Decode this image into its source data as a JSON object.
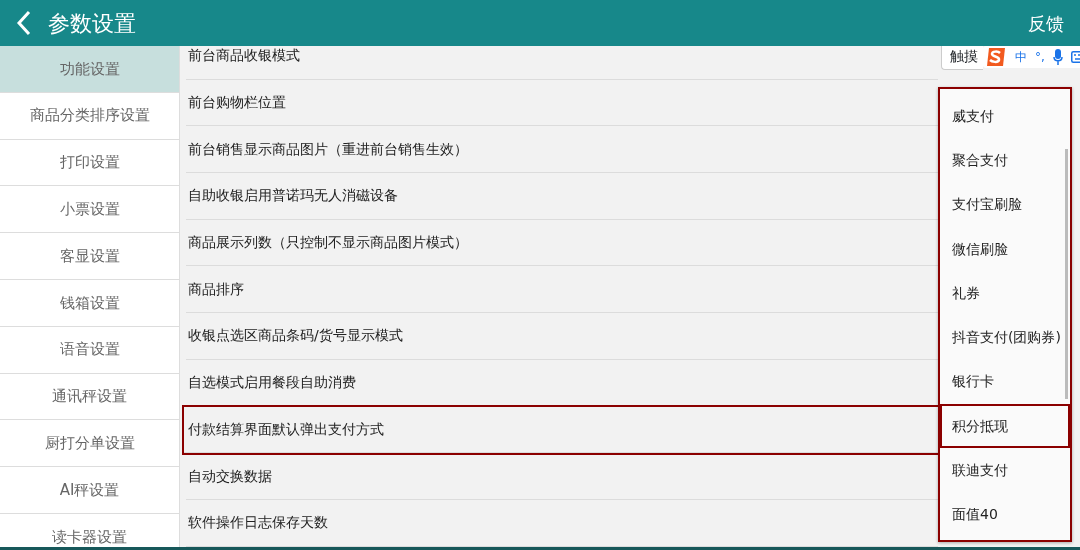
{
  "header": {
    "title": "参数设置",
    "action": "反馈"
  },
  "sidebar": {
    "items": [
      {
        "label": "功能设置",
        "selected": true
      },
      {
        "label": "商品分类排序设置",
        "selected": false
      },
      {
        "label": "打印设置",
        "selected": false
      },
      {
        "label": "小票设置",
        "selected": false
      },
      {
        "label": "客显设置",
        "selected": false
      },
      {
        "label": "钱箱设置",
        "selected": false
      },
      {
        "label": "语音设置",
        "selected": false
      },
      {
        "label": "通讯秤设置",
        "selected": false
      },
      {
        "label": "厨打分单设置",
        "selected": false
      },
      {
        "label": "AI秤设置",
        "selected": false
      },
      {
        "label": "读卡器设置",
        "selected": false
      }
    ]
  },
  "settings": [
    {
      "label": "前台商品收银模式",
      "highlighted": false
    },
    {
      "label": "前台购物栏位置",
      "highlighted": false
    },
    {
      "label": "前台销售显示商品图片（重进前台销售生效）",
      "highlighted": false
    },
    {
      "label": "自助收银启用普诺玛无人消磁设备",
      "highlighted": false
    },
    {
      "label": "商品展示列数（只控制不显示商品图片模式）",
      "highlighted": false
    },
    {
      "label": "商品排序",
      "highlighted": false
    },
    {
      "label": "收银点选区商品条码/货号显示模式",
      "highlighted": false
    },
    {
      "label": "自选模式启用餐段自助消费",
      "highlighted": false
    },
    {
      "label": "付款结算界面默认弹出支付方式",
      "highlighted": true
    },
    {
      "label": "自动交换数据",
      "highlighted": false
    },
    {
      "label": "软件操作日志保存天数",
      "highlighted": false
    }
  ],
  "first_select": {
    "value": "触摸"
  },
  "ime_toolbar": {
    "items": [
      "中",
      "°,"
    ]
  },
  "dropdown": {
    "outlined": true,
    "options": [
      {
        "label": "威支付",
        "highlighted": false
      },
      {
        "label": "聚合支付",
        "highlighted": false
      },
      {
        "label": "支付宝刷脸",
        "highlighted": false
      },
      {
        "label": "微信刷脸",
        "highlighted": false
      },
      {
        "label": "礼券",
        "highlighted": false
      },
      {
        "label": "抖音支付(团购券)",
        "highlighted": false
      },
      {
        "label": "银行卡",
        "highlighted": false
      },
      {
        "label": "积分抵现",
        "highlighted": true
      },
      {
        "label": "联迪支付",
        "highlighted": false
      },
      {
        "label": "面值40",
        "highlighted": false
      }
    ]
  }
}
